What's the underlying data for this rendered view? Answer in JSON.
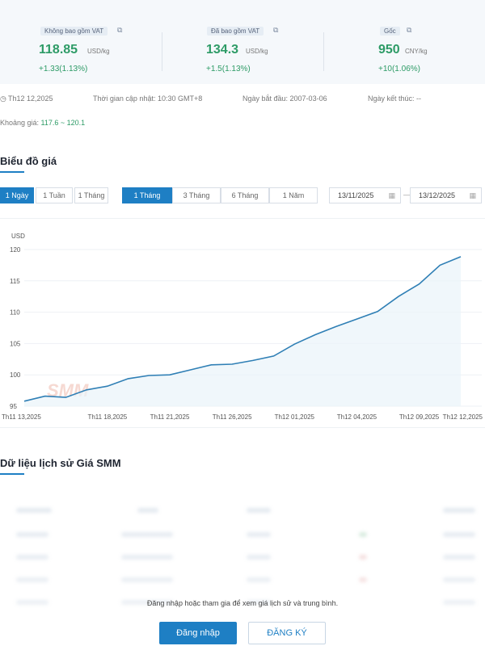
{
  "prices": [
    {
      "tag": "Không bao gồm VAT",
      "value": "118.85",
      "unit": "USD/kg",
      "change": "+1.33(1.13%)"
    },
    {
      "tag": "Đã bao gồm VAT",
      "value": "134.3",
      "unit": "USD/kg",
      "change": "+1.5(1.13%)"
    },
    {
      "tag": "Gốc",
      "value": "950",
      "unit": "CNY/kg",
      "change": "+10(1.06%)"
    }
  ],
  "meta": {
    "date": "Th12 12,2025",
    "update_time": "Thời gian cập nhật: 10:30 GMT+8",
    "start_date": "Ngày bắt đầu: 2007-03-06",
    "end_date": "Ngày kết thúc: --"
  },
  "range": {
    "label": "Khoảng giá: ",
    "value": "117.6 ~ 120.1"
  },
  "chart_section": {
    "title": "Biểu đồ giá"
  },
  "interval_buttons": [
    "1 Ngày",
    "1 Tuần",
    "1 Tháng"
  ],
  "period_buttons": [
    "1 Tháng",
    "3 Tháng",
    "6 Tháng",
    "1 Năm"
  ],
  "date_range": {
    "from": "13/11/2025",
    "to": "13/12/2025",
    "separator": "—"
  },
  "chart_data": {
    "type": "line",
    "ylabel": "USD",
    "ylim": [
      95,
      120
    ],
    "yticks": [
      95,
      100,
      105,
      110,
      115,
      120
    ],
    "xticks": [
      "Th11 13,2025",
      "Th11 18,2025",
      "Th11 21,2025",
      "Th11 26,2025",
      "Th12 01,2025",
      "Th12 04,2025",
      "Th12 09,2025",
      "Th12 12,2025"
    ],
    "xtick_index": [
      0,
      4,
      7,
      10,
      13,
      16,
      19,
      22
    ],
    "watermark": "SMM",
    "series": [
      {
        "values": [
          95.8,
          96.6,
          96.4,
          97.6,
          98.2,
          99.4,
          99.9,
          100.0,
          100.8,
          101.6,
          101.7,
          102.3,
          103.0,
          104.9,
          106.4,
          107.7,
          108.9,
          110.1,
          112.5,
          114.5,
          117.5,
          118.85
        ]
      }
    ],
    "grid": true,
    "color": "#2f7fb5"
  },
  "history_section": {
    "title": "Dữ liệu lịch sử Giá SMM"
  },
  "login": {
    "message": "Đăng nhập hoặc tham gia để xem giá lịch sử và trung bình.",
    "login_label": "Đăng nhập",
    "register_label": "ĐĂNG KÝ"
  }
}
